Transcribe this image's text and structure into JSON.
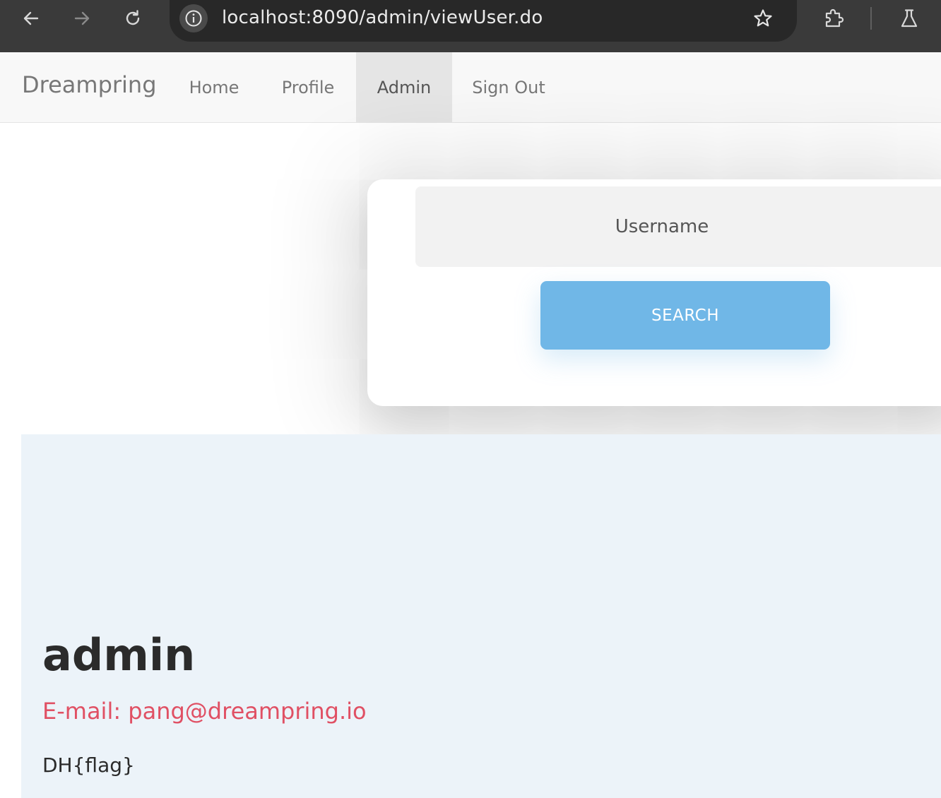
{
  "browser": {
    "url": "localhost:8090/admin/viewUser.do",
    "icons": {
      "back": "arrow-left-icon",
      "forward": "arrow-right-icon",
      "reload": "reload-icon",
      "site_info": "info-icon",
      "bookmark": "star-icon",
      "extensions": "puzzle-icon",
      "labs": "flask-icon"
    },
    "colors": {
      "toolbar": "#3a3a3a",
      "omnibox": "#282828",
      "text": "#ebebeb"
    }
  },
  "navbar": {
    "brand": "Dreampring",
    "items": [
      {
        "label": "Home",
        "active": false
      },
      {
        "label": "Profile",
        "active": false
      },
      {
        "label": "Admin",
        "active": true
      },
      {
        "label": "Sign Out",
        "active": false
      }
    ]
  },
  "search": {
    "placeholder": "Username",
    "value": "",
    "button_label": "SEARCH",
    "button_color": "#70b7e7"
  },
  "profile": {
    "name": "admin",
    "email_label": "E-mail:",
    "email_value": "pang@dreampring.io",
    "description": "DH{flag}",
    "background": "#ecf3f9",
    "email_color": "#e05064"
  }
}
